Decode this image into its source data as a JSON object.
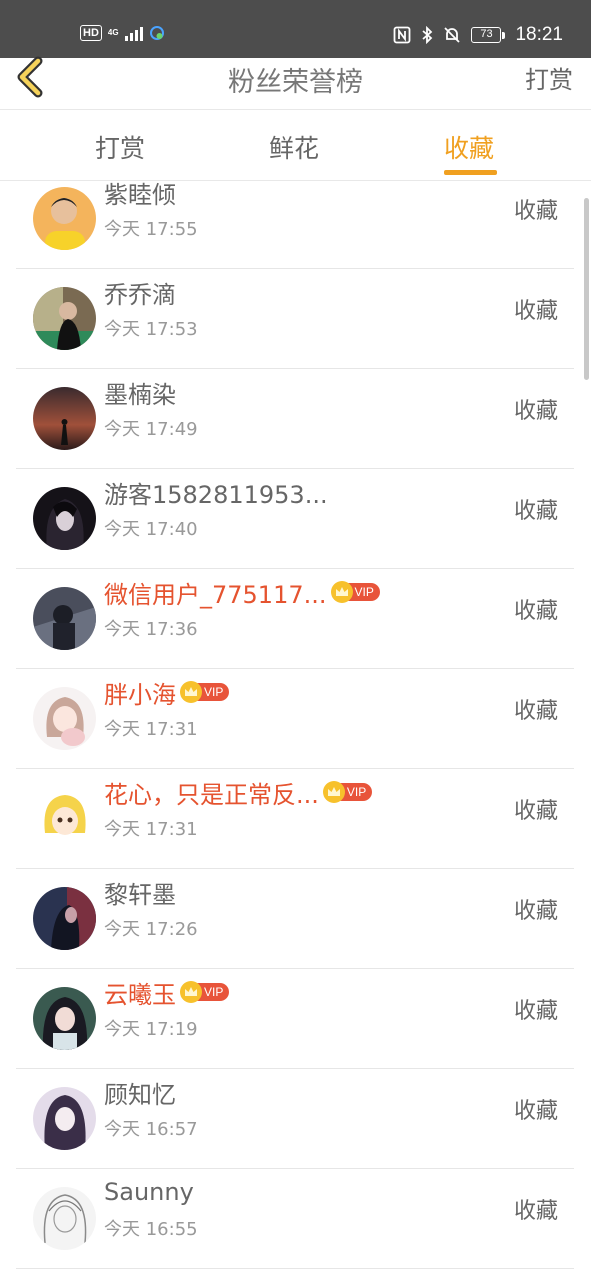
{
  "status_bar": {
    "hd_label": "HD",
    "network_label": "4G",
    "battery_level": "73",
    "time": "18:21"
  },
  "header": {
    "title": "粉丝荣誉榜",
    "right_action": "打赏"
  },
  "tabs": [
    {
      "label": "打赏",
      "active": false
    },
    {
      "label": "鲜花",
      "active": false
    },
    {
      "label": "收藏",
      "active": true
    }
  ],
  "vip_label": "VIP",
  "items": [
    {
      "name": "紫睦倾",
      "time": "今天 17:55",
      "action": "收藏",
      "vip": false
    },
    {
      "name": "乔乔滴",
      "time": "今天 17:53",
      "action": "收藏",
      "vip": false
    },
    {
      "name": "墨楠染",
      "time": "今天 17:49",
      "action": "收藏",
      "vip": false
    },
    {
      "name": "游客1582811953...",
      "time": "今天 17:40",
      "action": "收藏",
      "vip": false
    },
    {
      "name": "微信用户_775117...",
      "time": "今天 17:36",
      "action": "收藏",
      "vip": true
    },
    {
      "name": "胖小海",
      "time": "今天 17:31",
      "action": "收藏",
      "vip": true
    },
    {
      "name": "花心，只是正常反...",
      "time": "今天 17:31",
      "action": "收藏",
      "vip": true
    },
    {
      "name": "黎轩墨",
      "time": "今天 17:26",
      "action": "收藏",
      "vip": false
    },
    {
      "name": "云曦玉",
      "time": "今天 17:19",
      "action": "收藏",
      "vip": true
    },
    {
      "name": "顾知忆",
      "time": "今天 16:57",
      "action": "收藏",
      "vip": false
    },
    {
      "name": "Saunny",
      "time": "今天 16:55",
      "action": "收藏",
      "vip": false
    }
  ],
  "colors": {
    "accent": "#f0a020",
    "vip_name": "#e5532f",
    "vip_tag": "#e8543a",
    "status_bar": "#4d4d4d"
  }
}
